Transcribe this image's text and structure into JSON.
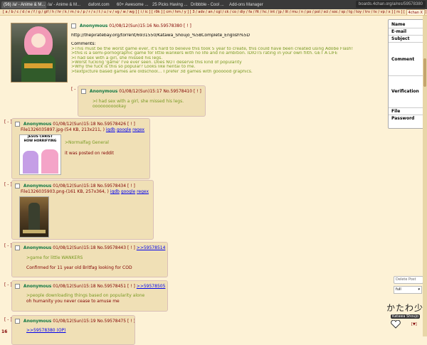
{
  "browser": {
    "tabs": [
      "(56) /a/ - Anime & M...",
      "/a/ - Anime & M...",
      "dafont.com",
      "60+ Awesome ...",
      "25 Picks Having ...",
      "Dribbble - Cool ...",
      "Add-ons Manager"
    ],
    "url": "boards.4chan.org/a/res/59578380"
  },
  "boards": {
    "list": "[ a / b / c / d / e / f / g / gif / h / hr / k / m / o / p / r / s / t / u / v / vg / w / wg ] [ i / ic ] [ r9k ] [ cm / hm / y ] [ 3 / adv / an / cgl / ck / co / diy / fa / fit / hc / int / jp / lit / mu / n / po / pol / sci / soc / sp / tg / toy / trv / tv / vp / x ] [ rs ] [ status / @ ]",
    "right": "4chan X"
  },
  "op": {
    "name": "Anonymous",
    "date": "01/08/12(Sun)15:16",
    "no": "No.59578380",
    "bracket": "[ ! ]",
    "url_line": "http://thepiratebay.org/torrent/6931550/Katawa_Shoujo_%5BComplete_English%5D",
    "comments_label": "Comments:",
    "lines": [
      ">This must be the worst game ever, it's hard to believe this took 5 year to create, this could have been created using Adobe Flash!",
      ">this is a semi-pornographic game for little wankers with no life and no ambition. IDIOTS rating in your own filth. GET A LIFE",
      ">I had sex with a girl, she missed his legs.",
      ">Worst fucking 'game' I've ever seen. Does NOT deserve this kind of popularity",
      ">Why the fuck is this so popular? Looks like hentai to me.",
      ">textpicture based games are oldschool... I prefer 3d games with goooood graphics."
    ]
  },
  "replies": [
    {
      "name": "Anonymous",
      "date": "01/08/12(Sun)15:17",
      "no": "No.59578410",
      "bracket": "[ ! ]",
      "lines": [
        ">I had sex with a girl, she missed his legs.",
        "ooooooooookay"
      ]
    },
    {
      "name": "Anonymous",
      "date": "01/08/12(Sun)15:18",
      "no": "No.59578426",
      "bracket": "[ ! ]",
      "file": "File1326035897.jpg-(54 KB, 213x211, )",
      "search": [
        "iqdb",
        "google",
        "regex"
      ],
      "thumb_text": "JESUS CHRIST\nHOW HORRIFYING",
      "lines": [
        ">Normalfag General",
        "it was posted on reddit"
      ]
    },
    {
      "name": "Anonymous",
      "date": "01/08/12(Sun)15:18",
      "no": "No.59578434",
      "bracket": "[ ! ]",
      "file": "File1326035903.png-(161 KB, 257x364, )",
      "search": [
        "iqdb",
        "google",
        "regex"
      ],
      "lines": []
    },
    {
      "name": "Anonymous",
      "date": "01/08/12(Sun)15:18",
      "no": "No.59578443",
      "bracket": "[ ! ]",
      "backlink": ">>59578514",
      "lines": [
        ">game for little WANKERS",
        "Confirmed for 11 year old Britfag looking for COD"
      ]
    },
    {
      "name": "Anonymous",
      "date": "01/08/12(Sun)15:18",
      "no": "No.59578451",
      "bracket": "[ ! ]",
      "backlink": ">>59578505",
      "lines": [
        ">people downloading things based on popularity alone",
        "oh humanity you never cease to amuse me"
      ]
    },
    {
      "name": "Anonymous",
      "date": "01/08/12(Sun)15:19",
      "no": "No.59578475",
      "bracket": "[ ! ]",
      "lines": [
        ">>59578380 (OP)"
      ]
    }
  ],
  "post_form": {
    "fields": [
      "Name",
      "E-mail",
      "Subject",
      "Comment",
      "Verification",
      "File",
      "Password"
    ]
  },
  "sidebar": {
    "delete_post": "Delete Post",
    "style": "full",
    "logo_jp": "かたわ少女",
    "logo_en": "Katawa Shoujo",
    "scroll_bottom": "[▼]"
  },
  "page_number": "16"
}
